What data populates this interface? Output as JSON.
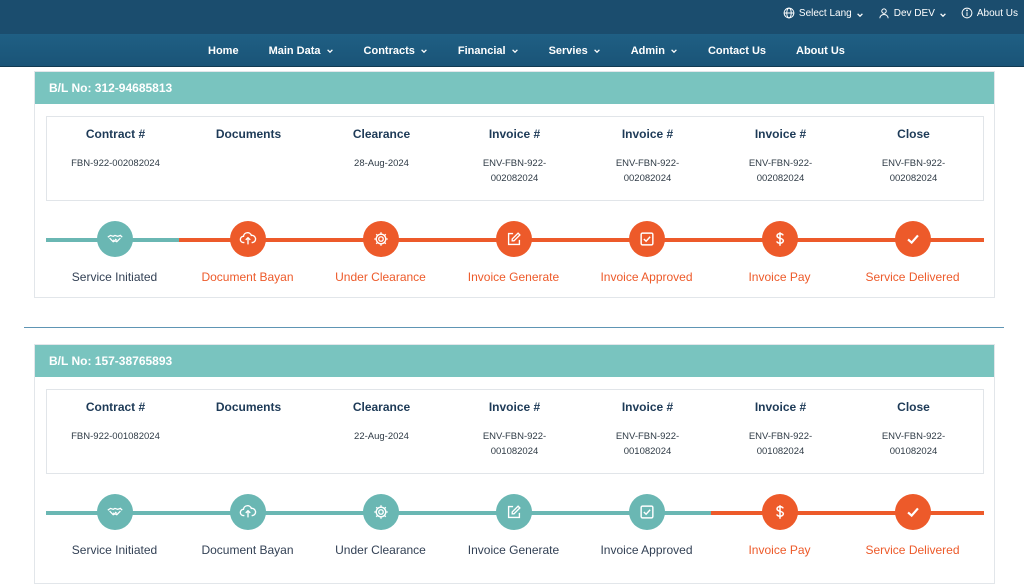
{
  "header": {
    "utility": [
      {
        "label": "Select Lang",
        "icon": "globe-icon",
        "dropdown": true
      },
      {
        "label": "Dev DEV",
        "icon": "user-icon",
        "dropdown": true
      },
      {
        "label": "About Us",
        "icon": "info-icon",
        "dropdown": false
      }
    ],
    "nav": [
      {
        "label": "Home",
        "dropdown": false
      },
      {
        "label": "Main Data",
        "dropdown": true
      },
      {
        "label": "Contracts",
        "dropdown": true
      },
      {
        "label": "Financial",
        "dropdown": true
      },
      {
        "label": "Servies",
        "dropdown": true
      },
      {
        "label": "Admin",
        "dropdown": true
      },
      {
        "label": "Contact Us",
        "dropdown": false
      },
      {
        "label": "About Us",
        "dropdown": false
      }
    ]
  },
  "colors": {
    "teal": "#6ab7b3",
    "orange": "#ed5a2a",
    "header_bg": "#79c4bf",
    "text_teal": "#334155",
    "text_orange": "#ed5a2a"
  },
  "columns": [
    "Contract #",
    "Documents",
    "Clearance",
    "Invoice #",
    "Invoice #",
    "Invoice #",
    "Close"
  ],
  "steps": [
    {
      "label": "Service Initiated",
      "icon": "handshake-icon"
    },
    {
      "label": "Document Bayan",
      "icon": "cloud-upload-icon"
    },
    {
      "label": "Under Clearance",
      "icon": "gear-icon"
    },
    {
      "label": "Invoice Generate",
      "icon": "edit-icon"
    },
    {
      "label": "Invoice Approved",
      "icon": "check-square-icon"
    },
    {
      "label": "Invoice Pay",
      "icon": "dollar-icon"
    },
    {
      "label": "Service Delivered",
      "icon": "check-icon"
    }
  ],
  "shipments": [
    {
      "bl": "B/L No: 312-94685813",
      "values": [
        [
          "FBN-922-002082024"
        ],
        [],
        [
          "28-Aug-2024"
        ],
        [
          "ENV-FBN-922-",
          "002082024"
        ],
        [
          "ENV-FBN-922-",
          "002082024"
        ],
        [
          "ENV-FBN-922-",
          "002082024"
        ],
        [
          "ENV-FBN-922-",
          "002082024"
        ]
      ],
      "completed_steps": 1
    },
    {
      "bl": "B/L No: 157-38765893",
      "values": [
        [
          "FBN-922-001082024"
        ],
        [],
        [
          "22-Aug-2024"
        ],
        [
          "ENV-FBN-922-",
          "001082024"
        ],
        [
          "ENV-FBN-922-",
          "001082024"
        ],
        [
          "ENV-FBN-922-",
          "001082024"
        ],
        [
          "ENV-FBN-922-",
          "001082024"
        ]
      ],
      "completed_steps": 5
    }
  ]
}
